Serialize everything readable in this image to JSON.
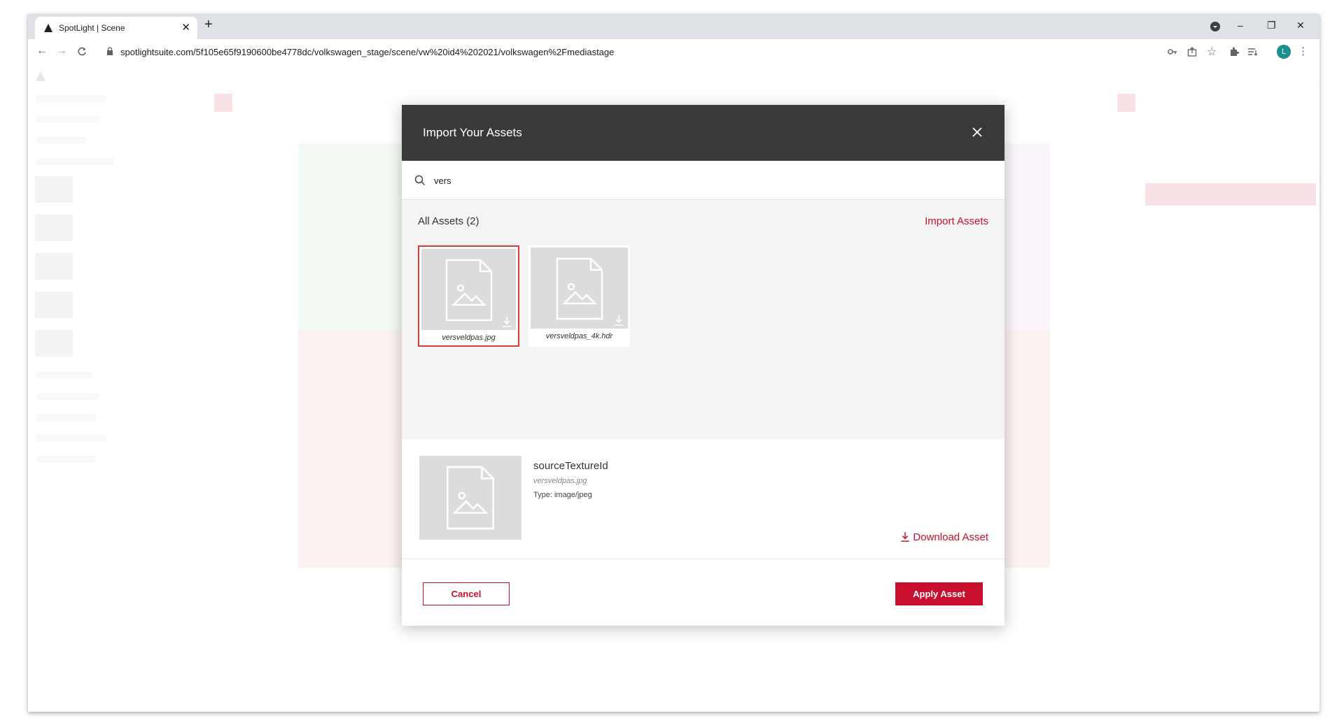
{
  "browser": {
    "tab_title": "SpotLight | Scene",
    "new_tab": "+",
    "url": "spotlightsuite.com/5f105e65f9190600be4778dc/volkswagen_stage/scene/vw%20id4%202021/volkswagen%2Fmediastage",
    "profile_initial": "L",
    "window_controls": {
      "minimize": "–",
      "restore": "❐",
      "close": "✕"
    },
    "nav": {
      "back": "←",
      "forward": "→",
      "reload": "C"
    }
  },
  "modal": {
    "title": "Import Your Assets",
    "search": {
      "value": "vers",
      "placeholder": ""
    },
    "assets_label": "All Assets (2)",
    "import_link": "Import Assets",
    "assets": [
      {
        "name": "versveldpas.jpg",
        "selected": true
      },
      {
        "name": "versveldpas_4k.hdr",
        "selected": false
      }
    ],
    "details": {
      "name": "sourceTextureId",
      "file": "versveldpas.jpg",
      "type": "Type: image/jpeg",
      "download_label": "Download Asset"
    },
    "cancel_label": "Cancel",
    "apply_label": "Apply Asset"
  },
  "colors": {
    "accent": "#c8102e",
    "header_bg": "#393939",
    "modal_bg": "#f4f4f4"
  }
}
